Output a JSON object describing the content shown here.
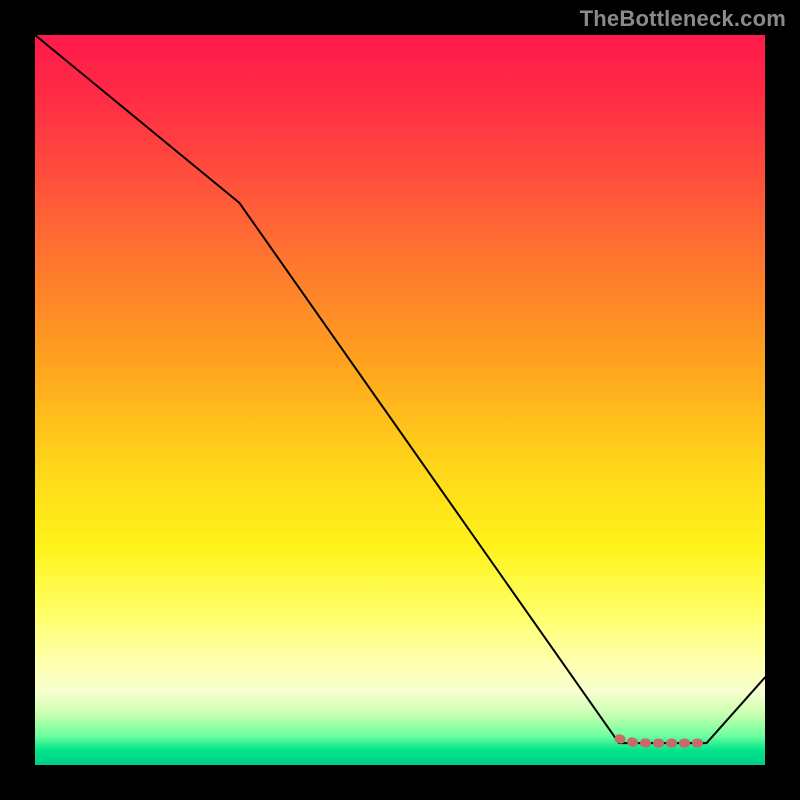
{
  "watermark": "TheBottleneck.com",
  "chart_data": {
    "type": "line",
    "title": "",
    "xlabel": "",
    "ylabel": "",
    "xlim": [
      0,
      100
    ],
    "ylim": [
      0,
      100
    ],
    "series": [
      {
        "name": "bottleneck-curve",
        "x": [
          0,
          28,
          80,
          92,
          100
        ],
        "y": [
          100,
          77,
          3,
          3,
          12
        ],
        "color": "#000000",
        "stroke_width": 2
      },
      {
        "name": "optimal-range-marker",
        "x": [
          80,
          82,
          84,
          86,
          88,
          90,
          92
        ],
        "y": [
          3.6,
          3.1,
          3.0,
          3.0,
          3.0,
          3.0,
          3.0
        ],
        "color": "#c96a6a",
        "stroke_width": 9,
        "dashed": true
      }
    ],
    "background_gradient": {
      "orientation": "vertical",
      "stops": [
        {
          "pos": 0.0,
          "color": "#ff1a4d"
        },
        {
          "pos": 0.45,
          "color": "#ffa31f"
        },
        {
          "pos": 0.7,
          "color": "#fff31a"
        },
        {
          "pos": 0.9,
          "color": "#f7ffd0"
        },
        {
          "pos": 0.98,
          "color": "#00e58a"
        },
        {
          "pos": 1.0,
          "color": "#00cc88"
        }
      ]
    }
  }
}
